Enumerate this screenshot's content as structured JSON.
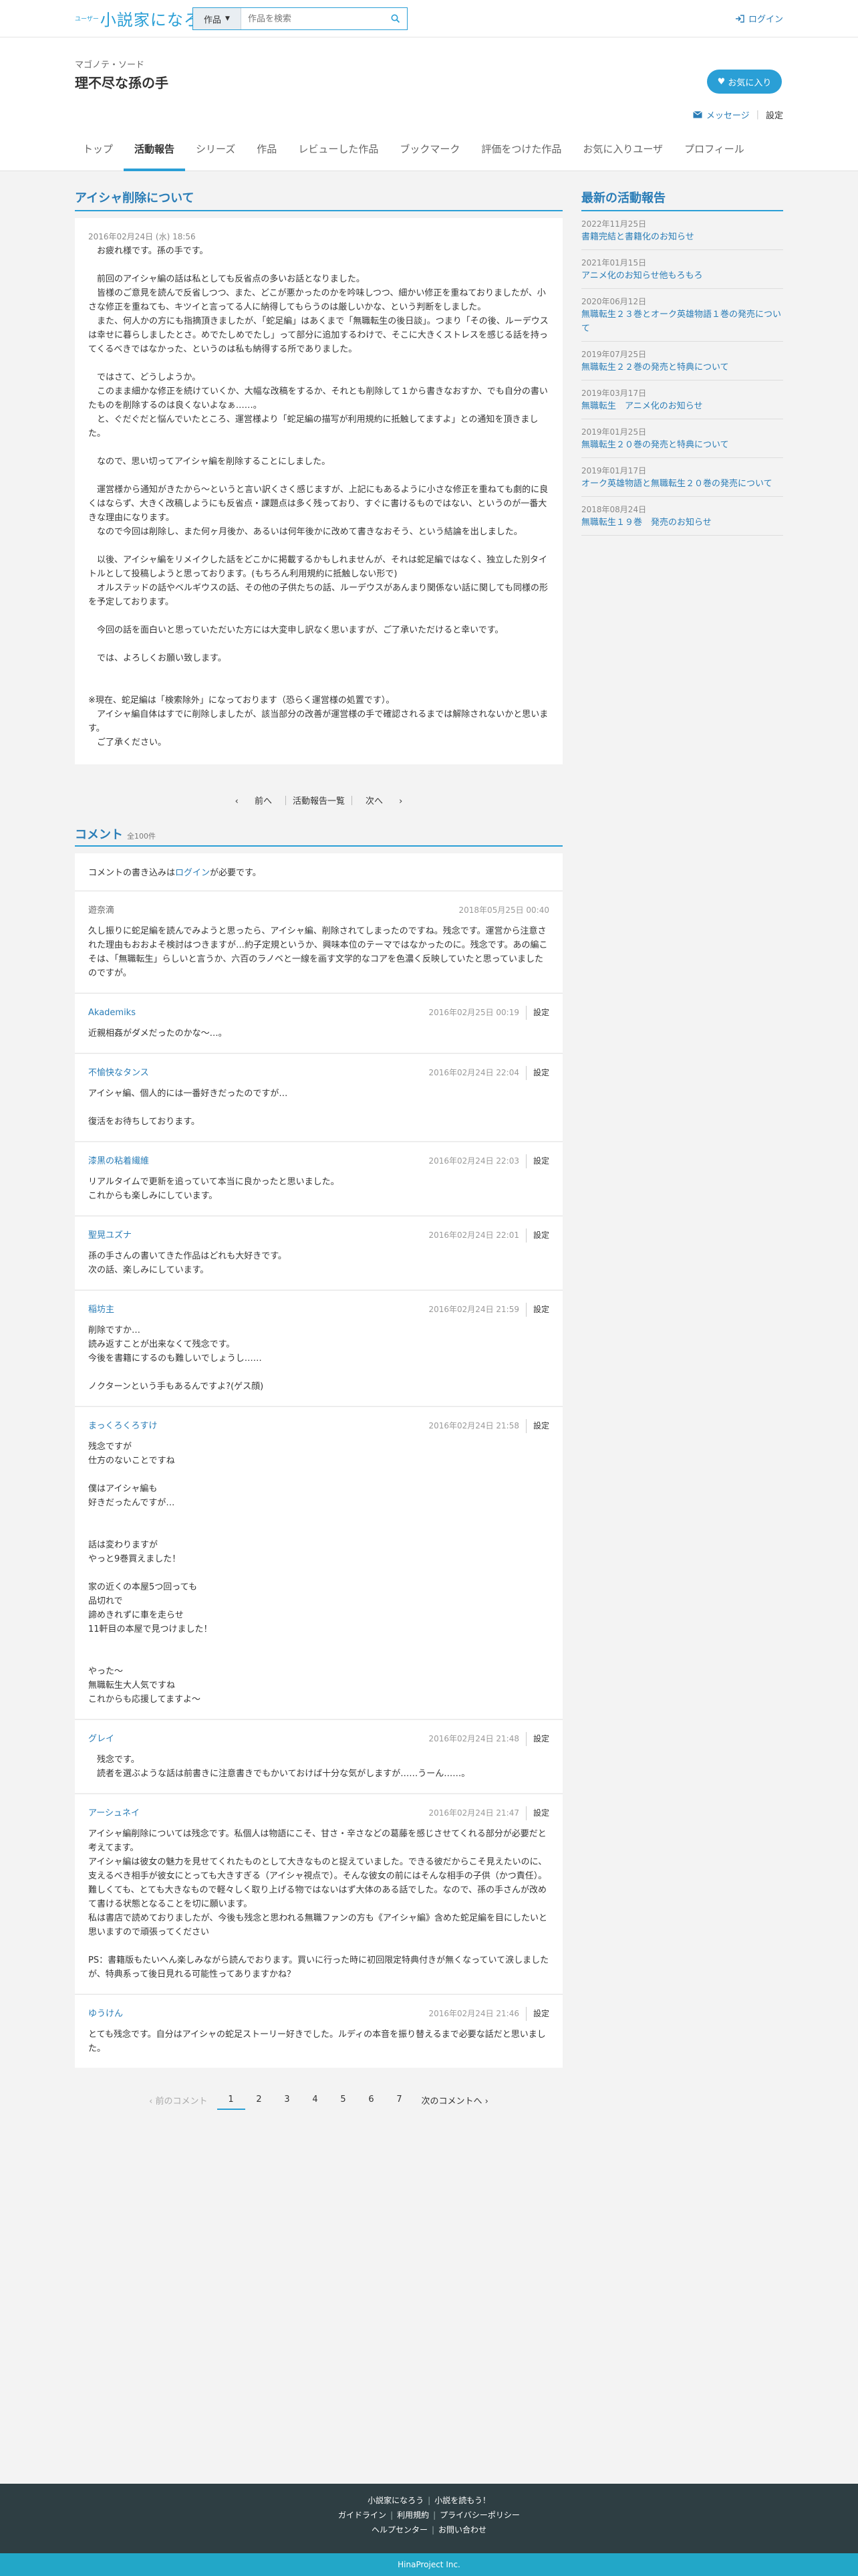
{
  "topbar": {
    "logo_small": "ユーザー",
    "logo_text": "小説家になろう",
    "search_category": "作品",
    "search_placeholder": "作品を検索",
    "login_label": "ログイン"
  },
  "profile": {
    "pen_name": "マゴノテ・ソード",
    "user_name": "理不尽な孫の手",
    "favorite_button": "お気に入り",
    "message_label": "メッセージ",
    "settings_label": "設定"
  },
  "tabs": [
    {
      "label": "トップ",
      "active": false
    },
    {
      "label": "活動報告",
      "active": true
    },
    {
      "label": "シリーズ",
      "active": false
    },
    {
      "label": "作品",
      "active": false
    },
    {
      "label": "レビューした作品",
      "active": false
    },
    {
      "label": "ブックマーク",
      "active": false
    },
    {
      "label": "評価をつけた作品",
      "active": false
    },
    {
      "label": "お気に入りユーザ",
      "active": false
    },
    {
      "label": "プロフィール",
      "active": false
    }
  ],
  "report": {
    "title": "アイシャ削除について",
    "date": "2016年02月24日 (水) 18:56",
    "body": "　お疲れ様です。孫の手です。\n\n　前回のアイシャ編の話は私としても反省点の多いお話となりました。\n　皆様のご意見を読んで反省しつつ、また、どこが悪かったのかを吟味しつつ、細かい修正を重ねておりましたが、小さな修正を重ねても、キツイと言ってる人に納得してもらうのは厳しいかな、という判断をしました。\n　また、何人かの方にも指摘頂きましたが、「蛇足編」はあくまで「無職転生の後日談」。つまり「その後、ルーデウスは幸せに暮らしましたとさ。めでたしめでたし」って部分に追加するわけで、そこに大きくストレスを感じる話を持ってくるべきではなかった、というのは私も納得する所でありました。\n\n　ではさて、どうしようか。\n　このまま細かな修正を続けていくか、大幅な改稿をするか、それとも削除して１から書きなおすか、でも自分の書いたものを削除するのは良くないよなぁ……。\n　と、ぐだぐだと悩んでいたところ、運営様より「蛇足編の描写が利用規約に抵触してますよ」との通知を頂きました。\n\n　なので、思い切ってアイシャ編を削除することにしました。\n\n　運営様から通知がきたから～というと言い訳くさく感じますが、上記にもあるように小さな修正を重ねても劇的に良くはならず、大きく改稿しようにも反省点・課題点は多く残っており、すぐに書けるものではない、というのが一番大きな理由になります。\n　なので今回は削除し、また何ヶ月後か、あるいは何年後かに改めて書きなおそう、という結論を出しました。\n\n　以後、アイシャ編をリメイクした話をどこかに掲載するかもしれませんが、それは蛇足編ではなく、独立した別タイトルとして投稿しようと思っております。(もちろん利用規約に抵触しない形で)\n　オルステッドの話やベルギウスの話、その他の子供たちの話、ルーデウスがあんまり関係ない話に関しても同様の形を予定しております。\n\n　今回の話を面白いと思っていただいた方には大変申し訳なく思いますが、ご了承いただけると幸いです。\n\n　では、よろしくお願い致します。\n\n\n※現在、蛇足編は「検索除外」になっております（恐らく運営様の処置です）。\n　アイシャ編自体はすでに削除しましたが、該当部分の改善が運営様の手で確認されるまでは解除されないかと思います。\n　ご了承ください。"
  },
  "report_pager": {
    "prev": "前へ",
    "list": "活動報告一覧",
    "next": "次へ"
  },
  "comments_section": {
    "title": "コメント",
    "count": "全100件",
    "login_note_pre": "コメントの書き込みは",
    "login_note_link": "ログイン",
    "login_note_post": "が必要です。",
    "settings_label": "設定"
  },
  "comments": [
    {
      "author": "遊奈滴",
      "linked": false,
      "date": "2018年05月25日 00:40",
      "has_settings": false,
      "body": "久し振りに蛇足編を読んでみようと思ったら、アイシャ編、削除されてしまったのですね。残念です。運営から注意された理由もおおよそ検討はつきますが…約子定規というか、興味本位のテーマではなかったのに。残念です。あの編こそは、「無職転生」らしいと言うか、六百のラノベと一線を画す文学的なコアを色濃く反映していたと思っていましたのですが。"
    },
    {
      "author": "Akademiks",
      "linked": true,
      "date": "2016年02月25日 00:19",
      "has_settings": true,
      "body": "近親相姦がダメだったのかな～…。"
    },
    {
      "author": "不愉快なタンス",
      "linked": true,
      "date": "2016年02月24日 22:04",
      "has_settings": true,
      "body": "アイシャ編、個人的には一番好きだったのですが…\n\n復活をお待ちしております。"
    },
    {
      "author": "漆黒の粘着繊維",
      "linked": true,
      "date": "2016年02月24日 22:03",
      "has_settings": true,
      "body": "リアルタイムで更新を追っていて本当に良かったと思いました。\nこれからも楽しみにしています。"
    },
    {
      "author": "聖晃ユズナ",
      "linked": true,
      "date": "2016年02月24日 22:01",
      "has_settings": true,
      "body": "孫の手さんの書いてきた作品はどれも大好きです。\n次の話、楽しみにしています。"
    },
    {
      "author": "稲坊主",
      "linked": true,
      "date": "2016年02月24日 21:59",
      "has_settings": true,
      "body": "削除ですか…\n読み返すことが出来なくて残念です。\n今後を書籍にするのも難しいでしょうし……\n\nノクターンという手もあるんですよ?(ゲス顔)"
    },
    {
      "author": "まっくろくろすけ",
      "linked": true,
      "date": "2016年02月24日 21:58",
      "has_settings": true,
      "body": "残念ですが\n仕方のないことですね\n\n僕はアイシャ編も\n好きだったんですが…\n\n\n話は変わりますが\nやっと9巻買えました！\n\n家の近くの本屋5つ回っても\n品切れで\n諦めきれずに車を走らせ\n11軒目の本屋で見つけました！\n\n\nやった～\n無職転生大人気ですね\nこれからも応援してますよ～"
    },
    {
      "author": "グレイ",
      "linked": true,
      "date": "2016年02月24日 21:48",
      "has_settings": true,
      "body": "　残念です。\n　読者を選ぶような話は前書きに注意書きでもかいておけば十分な気がしますが……うーん……。"
    },
    {
      "author": "アーシュネイ",
      "linked": true,
      "date": "2016年02月24日 21:47",
      "has_settings": true,
      "body": "アイシャ編削除については残念です。私個人は物語にこそ、甘さ・辛さなどの葛藤を感じさせてくれる部分が必要だと考えてます。\nアイシャ編は彼女の魅力を見せてくれたものとして大きなものと捉えていました。できる彼だからこそ見えたいのに、支えるべき相手が彼女にとっても大きすぎる（アイシャ視点で）。そんな彼女の前にはそんな相手の子供（かつ責任）。\n難しくても、とても大きなもので軽々しく取り上げる物ではないはず大体のある話でした。なので、孫の手さんが改めて書ける状態となることを切に願います。\n私は書店で読めておりましたが、今後も残念と思われる無職ファンの方も《アイシャ編》含めた蛇足編を目にしたいと思いますので頑張ってください\n\nPS：書籍版もたいへん楽しみながら読んでおります。買いに行った時に初回限定特典付きが無くなっていて涙しましたが、特典系って後日見れる可能性ってありますかね？"
    },
    {
      "author": "ゆうけん",
      "linked": true,
      "date": "2016年02月24日 21:46",
      "has_settings": true,
      "body": "とても残念です。自分はアイシャの蛇足ストーリー好きでした。ルディの本音を振り替えるまで必要な話だと思いました。"
    }
  ],
  "pagination": {
    "prev_label": "前のコメント",
    "pages": [
      "1",
      "2",
      "3",
      "4",
      "5",
      "6",
      "7"
    ],
    "current": "1",
    "next_label": "次のコメントへ"
  },
  "sidebar": {
    "title": "最新の活動報告",
    "items": [
      {
        "date": "2022年11月25日",
        "title": "書籍完結と書籍化のお知らせ"
      },
      {
        "date": "2021年01月15日",
        "title": "アニメ化のお知らせ他もろもろ"
      },
      {
        "date": "2020年06月12日",
        "title": "無職転生２３巻とオーク英雄物語１巻の発売について"
      },
      {
        "date": "2019年07月25日",
        "title": "無職転生２２巻の発売と特典について"
      },
      {
        "date": "2019年03月17日",
        "title": "無職転生　アニメ化のお知らせ"
      },
      {
        "date": "2019年01月25日",
        "title": "無職転生２０巻の発売と特典について"
      },
      {
        "date": "2019年01月17日",
        "title": "オーク英雄物語と無職転生２０巻の発売について"
      },
      {
        "date": "2018年08月24日",
        "title": "無職転生１９巻　発売のお知らせ"
      }
    ]
  },
  "footer": {
    "row1": [
      "小説家になろう",
      "小説を読もう！"
    ],
    "row2": [
      "ガイドライン",
      "利用規約",
      "プライバシーポリシー"
    ],
    "row3": [
      "ヘルプセンター",
      "お問い合わせ"
    ],
    "copyright": "HinaProject Inc."
  },
  "colors": {
    "accent": "#2a9fd6",
    "link": "#2a7db7",
    "footer": "#2e3e43",
    "copyright_bar": "#22a7c8"
  }
}
